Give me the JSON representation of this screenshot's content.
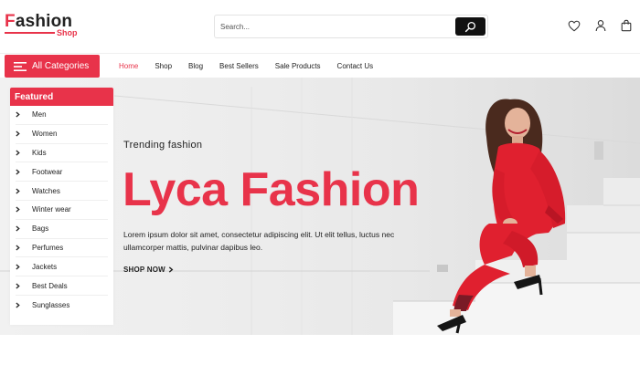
{
  "header": {
    "logo": {
      "first_letter": "F",
      "rest": "ashion",
      "sub": "Shop"
    },
    "search": {
      "placeholder": "Search..."
    },
    "icons": [
      "heart-icon",
      "user-icon",
      "shopping-bag-icon"
    ]
  },
  "nav": {
    "categories_button": "All Categories",
    "links": [
      {
        "label": "Home",
        "active": true
      },
      {
        "label": "Shop",
        "active": false
      },
      {
        "label": "Blog",
        "active": false
      },
      {
        "label": "Best Sellers",
        "active": false
      },
      {
        "label": "Sale Products",
        "active": false
      },
      {
        "label": "Contact Us",
        "active": false
      }
    ]
  },
  "sidebar": {
    "title": "Featured",
    "items": [
      {
        "label": "Men"
      },
      {
        "label": "Women"
      },
      {
        "label": "Kids"
      },
      {
        "label": "Footwear"
      },
      {
        "label": "Watches"
      },
      {
        "label": "Winter wear"
      },
      {
        "label": "Bags"
      },
      {
        "label": "Perfumes"
      },
      {
        "label": "Jackets"
      },
      {
        "label": "Best Deals"
      },
      {
        "label": "Sunglasses"
      }
    ]
  },
  "hero": {
    "kicker": "Trending fashion",
    "title": "Lyca Fashion",
    "description": "Lorem ipsum dolor sit amet, consectetur adipiscing elit. Ut elit tellus, luctus nec ullamcorper mattis, pulvinar dapibus leo.",
    "cta": "SHOP NOW",
    "cta_icon": "chevron-right-icon"
  },
  "colors": {
    "accent": "#e8334a",
    "text": "#222222",
    "search_button": "#111111"
  }
}
